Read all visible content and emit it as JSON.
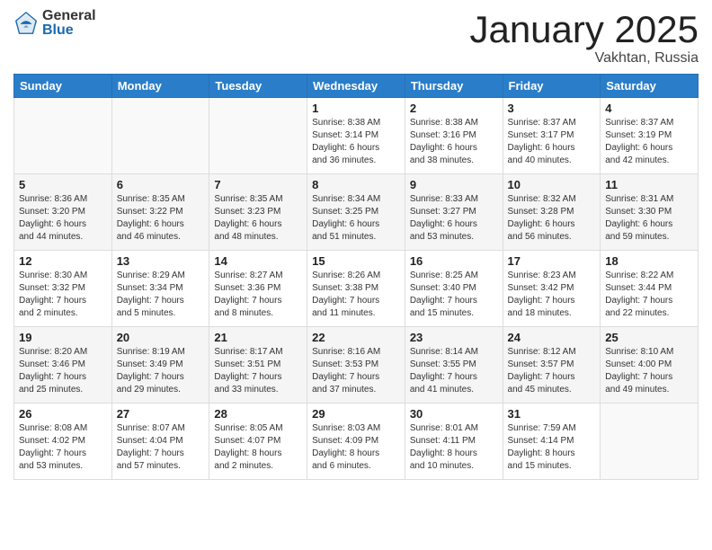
{
  "logo": {
    "general": "General",
    "blue": "Blue"
  },
  "header": {
    "month": "January 2025",
    "location": "Vakhtan, Russia"
  },
  "weekdays": [
    "Sunday",
    "Monday",
    "Tuesday",
    "Wednesday",
    "Thursday",
    "Friday",
    "Saturday"
  ],
  "weeks": [
    [
      {
        "day": "",
        "info": ""
      },
      {
        "day": "",
        "info": ""
      },
      {
        "day": "",
        "info": ""
      },
      {
        "day": "1",
        "info": "Sunrise: 8:38 AM\nSunset: 3:14 PM\nDaylight: 6 hours\nand 36 minutes."
      },
      {
        "day": "2",
        "info": "Sunrise: 8:38 AM\nSunset: 3:16 PM\nDaylight: 6 hours\nand 38 minutes."
      },
      {
        "day": "3",
        "info": "Sunrise: 8:37 AM\nSunset: 3:17 PM\nDaylight: 6 hours\nand 40 minutes."
      },
      {
        "day": "4",
        "info": "Sunrise: 8:37 AM\nSunset: 3:19 PM\nDaylight: 6 hours\nand 42 minutes."
      }
    ],
    [
      {
        "day": "5",
        "info": "Sunrise: 8:36 AM\nSunset: 3:20 PM\nDaylight: 6 hours\nand 44 minutes."
      },
      {
        "day": "6",
        "info": "Sunrise: 8:35 AM\nSunset: 3:22 PM\nDaylight: 6 hours\nand 46 minutes."
      },
      {
        "day": "7",
        "info": "Sunrise: 8:35 AM\nSunset: 3:23 PM\nDaylight: 6 hours\nand 48 minutes."
      },
      {
        "day": "8",
        "info": "Sunrise: 8:34 AM\nSunset: 3:25 PM\nDaylight: 6 hours\nand 51 minutes."
      },
      {
        "day": "9",
        "info": "Sunrise: 8:33 AM\nSunset: 3:27 PM\nDaylight: 6 hours\nand 53 minutes."
      },
      {
        "day": "10",
        "info": "Sunrise: 8:32 AM\nSunset: 3:28 PM\nDaylight: 6 hours\nand 56 minutes."
      },
      {
        "day": "11",
        "info": "Sunrise: 8:31 AM\nSunset: 3:30 PM\nDaylight: 6 hours\nand 59 minutes."
      }
    ],
    [
      {
        "day": "12",
        "info": "Sunrise: 8:30 AM\nSunset: 3:32 PM\nDaylight: 7 hours\nand 2 minutes."
      },
      {
        "day": "13",
        "info": "Sunrise: 8:29 AM\nSunset: 3:34 PM\nDaylight: 7 hours\nand 5 minutes."
      },
      {
        "day": "14",
        "info": "Sunrise: 8:27 AM\nSunset: 3:36 PM\nDaylight: 7 hours\nand 8 minutes."
      },
      {
        "day": "15",
        "info": "Sunrise: 8:26 AM\nSunset: 3:38 PM\nDaylight: 7 hours\nand 11 minutes."
      },
      {
        "day": "16",
        "info": "Sunrise: 8:25 AM\nSunset: 3:40 PM\nDaylight: 7 hours\nand 15 minutes."
      },
      {
        "day": "17",
        "info": "Sunrise: 8:23 AM\nSunset: 3:42 PM\nDaylight: 7 hours\nand 18 minutes."
      },
      {
        "day": "18",
        "info": "Sunrise: 8:22 AM\nSunset: 3:44 PM\nDaylight: 7 hours\nand 22 minutes."
      }
    ],
    [
      {
        "day": "19",
        "info": "Sunrise: 8:20 AM\nSunset: 3:46 PM\nDaylight: 7 hours\nand 25 minutes."
      },
      {
        "day": "20",
        "info": "Sunrise: 8:19 AM\nSunset: 3:49 PM\nDaylight: 7 hours\nand 29 minutes."
      },
      {
        "day": "21",
        "info": "Sunrise: 8:17 AM\nSunset: 3:51 PM\nDaylight: 7 hours\nand 33 minutes."
      },
      {
        "day": "22",
        "info": "Sunrise: 8:16 AM\nSunset: 3:53 PM\nDaylight: 7 hours\nand 37 minutes."
      },
      {
        "day": "23",
        "info": "Sunrise: 8:14 AM\nSunset: 3:55 PM\nDaylight: 7 hours\nand 41 minutes."
      },
      {
        "day": "24",
        "info": "Sunrise: 8:12 AM\nSunset: 3:57 PM\nDaylight: 7 hours\nand 45 minutes."
      },
      {
        "day": "25",
        "info": "Sunrise: 8:10 AM\nSunset: 4:00 PM\nDaylight: 7 hours\nand 49 minutes."
      }
    ],
    [
      {
        "day": "26",
        "info": "Sunrise: 8:08 AM\nSunset: 4:02 PM\nDaylight: 7 hours\nand 53 minutes."
      },
      {
        "day": "27",
        "info": "Sunrise: 8:07 AM\nSunset: 4:04 PM\nDaylight: 7 hours\nand 57 minutes."
      },
      {
        "day": "28",
        "info": "Sunrise: 8:05 AM\nSunset: 4:07 PM\nDaylight: 8 hours\nand 2 minutes."
      },
      {
        "day": "29",
        "info": "Sunrise: 8:03 AM\nSunset: 4:09 PM\nDaylight: 8 hours\nand 6 minutes."
      },
      {
        "day": "30",
        "info": "Sunrise: 8:01 AM\nSunset: 4:11 PM\nDaylight: 8 hours\nand 10 minutes."
      },
      {
        "day": "31",
        "info": "Sunrise: 7:59 AM\nSunset: 4:14 PM\nDaylight: 8 hours\nand 15 minutes."
      },
      {
        "day": "",
        "info": ""
      }
    ]
  ]
}
